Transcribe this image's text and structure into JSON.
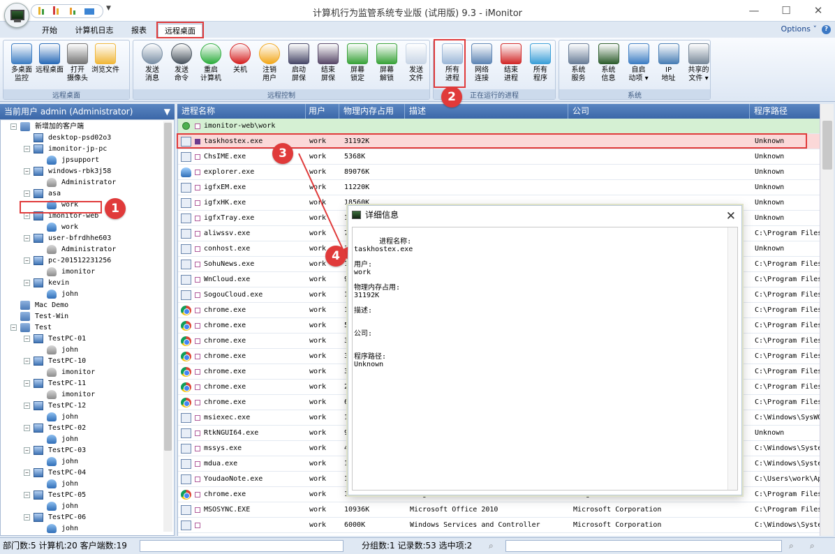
{
  "window": {
    "title": "计算机行为监管系统专业版 (试用版) 9.3 - iMonitor",
    "minimize": "—",
    "maximize": "☐",
    "close": "✕"
  },
  "tabs": [
    "开始",
    "计算机日志",
    "报表",
    "远程桌面"
  ],
  "options_label": "Options ˅",
  "help_label": "?",
  "ribbon": {
    "groups": [
      {
        "label": "远程桌面",
        "buttons": [
          {
            "l1": "多桌面",
            "l2": "监控",
            "icon": "multi-desktop-icon",
            "color": "#3f7fc4"
          },
          {
            "l1": "远程桌面",
            "l2": "",
            "icon": "remote-desktop-icon",
            "color": "#2b6cb8"
          },
          {
            "l1": "打开",
            "l2": "摄像头",
            "icon": "webcam-icon",
            "color": "#777777"
          },
          {
            "l1": "浏览文件",
            "l2": "",
            "icon": "folder-icon",
            "color": "#f0b73a"
          }
        ]
      },
      {
        "label": "远程控制",
        "buttons": [
          {
            "l1": "发送",
            "l2": "消息",
            "icon": "message-icon",
            "color": "#7a8fa5"
          },
          {
            "l1": "发送",
            "l2": "命令",
            "icon": "command-icon",
            "color": "#4a5560"
          },
          {
            "l1": "重启",
            "l2": "计算机",
            "icon": "restart-icon",
            "color": "#2fae3f"
          },
          {
            "l1": "关机",
            "l2": "",
            "icon": "shutdown-icon",
            "color": "#d52222"
          },
          {
            "l1": "注销",
            "l2": "用户",
            "icon": "logoff-key-icon",
            "color": "#f2a81d"
          },
          {
            "l1": "启动",
            "l2": "屏保",
            "icon": "screensaver-start-icon",
            "color": "#4a4a6a"
          },
          {
            "l1": "结束",
            "l2": "屏保",
            "icon": "screensaver-stop-icon",
            "color": "#5a4a6a"
          },
          {
            "l1": "屏幕",
            "l2": "锁定",
            "icon": "screen-lock-icon",
            "color": "#3aa33a"
          },
          {
            "l1": "屏幕",
            "l2": "解锁",
            "icon": "screen-unlock-icon",
            "color": "#3aa33a"
          },
          {
            "l1": "发送",
            "l2": "文件",
            "icon": "send-file-icon",
            "color": "#c9d6e6"
          }
        ]
      },
      {
        "label": "正在运行的进程",
        "buttons": [
          {
            "l1": "所有",
            "l2": "进程",
            "icon": "all-processes-icon",
            "color": "#9db8d8"
          },
          {
            "l1": "网络",
            "l2": "连接",
            "icon": "network-connection-icon",
            "color": "#5f86b5"
          },
          {
            "l1": "结束",
            "l2": "进程",
            "icon": "end-process-icon",
            "color": "#d22a2a"
          },
          {
            "l1": "所有",
            "l2": "程序",
            "icon": "all-programs-icon",
            "color": "#3b9fd8"
          }
        ]
      },
      {
        "label": "系统",
        "buttons": [
          {
            "l1": "系统",
            "l2": "服务",
            "icon": "system-services-icon",
            "color": "#6b7f99"
          },
          {
            "l1": "系统",
            "l2": "信息",
            "icon": "system-info-icon",
            "color": "#2f5f2f"
          },
          {
            "l1": "自启",
            "l2": "动项 ▾",
            "icon": "startup-gear-icon",
            "color": "#3f7fc4"
          },
          {
            "l1": "IP",
            "l2": "地址",
            "icon": "ip-address-icon",
            "color": "#4a7fb5"
          },
          {
            "l1": "共享的",
            "l2": "文件 ▾",
            "icon": "shared-files-icon",
            "color": "#7a8a9a"
          }
        ]
      }
    ]
  },
  "sidebar": {
    "header": "当前用户 admin (Administrator)",
    "tree": [
      {
        "t": "新增加的客户端",
        "lvl": 0,
        "icon": "net",
        "exp": "−"
      },
      {
        "t": "desktop-psd02o3",
        "lvl": 1,
        "icon": "pc",
        "exp": ""
      },
      {
        "t": "imonitor-jp-pc",
        "lvl": 1,
        "icon": "pc",
        "exp": "−"
      },
      {
        "t": "jpsupport",
        "lvl": 2,
        "icon": "user",
        "exp": ""
      },
      {
        "t": "windows-rbk3j58",
        "lvl": 1,
        "icon": "pc",
        "exp": "−"
      },
      {
        "t": "Administrator",
        "lvl": 2,
        "icon": "usergrey",
        "exp": ""
      },
      {
        "t": "asa",
        "lvl": 1,
        "icon": "pc",
        "exp": "−"
      },
      {
        "t": "work",
        "lvl": 2,
        "icon": "user",
        "exp": ""
      },
      {
        "t": "imonitor-web",
        "lvl": 1,
        "icon": "pc",
        "exp": "−"
      },
      {
        "t": "work",
        "lvl": 2,
        "icon": "user",
        "exp": ""
      },
      {
        "t": "user-bfrdhhe603",
        "lvl": 1,
        "icon": "pc",
        "exp": "−"
      },
      {
        "t": "Administrator",
        "lvl": 2,
        "icon": "usergrey",
        "exp": ""
      },
      {
        "t": "pc-201512231256",
        "lvl": 1,
        "icon": "pc",
        "exp": "−"
      },
      {
        "t": "imonitor",
        "lvl": 2,
        "icon": "usergrey",
        "exp": ""
      },
      {
        "t": "kevin",
        "lvl": 1,
        "icon": "pc",
        "exp": "−"
      },
      {
        "t": "john",
        "lvl": 2,
        "icon": "user",
        "exp": ""
      },
      {
        "t": "Mac Demo",
        "lvl": 0,
        "icon": "net",
        "exp": ""
      },
      {
        "t": "Test-Win",
        "lvl": 0,
        "icon": "net",
        "exp": ""
      },
      {
        "t": "Test",
        "lvl": 0,
        "icon": "net",
        "exp": "−"
      },
      {
        "t": "TestPC-01",
        "lvl": 1,
        "icon": "pc",
        "exp": "−"
      },
      {
        "t": "john",
        "lvl": 2,
        "icon": "usergrey",
        "exp": ""
      },
      {
        "t": "TestPC-10",
        "lvl": 1,
        "icon": "pc",
        "exp": "−"
      },
      {
        "t": "imonitor",
        "lvl": 2,
        "icon": "usergrey",
        "exp": ""
      },
      {
        "t": "TestPC-11",
        "lvl": 1,
        "icon": "pc",
        "exp": "−"
      },
      {
        "t": "imonitor",
        "lvl": 2,
        "icon": "usergrey",
        "exp": ""
      },
      {
        "t": "TestPC-12",
        "lvl": 1,
        "icon": "pc",
        "exp": "−"
      },
      {
        "t": "john",
        "lvl": 2,
        "icon": "user",
        "exp": ""
      },
      {
        "t": "TestPC-02",
        "lvl": 1,
        "icon": "pc",
        "exp": "−"
      },
      {
        "t": "john",
        "lvl": 2,
        "icon": "user",
        "exp": ""
      },
      {
        "t": "TestPC-03",
        "lvl": 1,
        "icon": "pc",
        "exp": "−"
      },
      {
        "t": "john",
        "lvl": 2,
        "icon": "user",
        "exp": ""
      },
      {
        "t": "TestPC-04",
        "lvl": 1,
        "icon": "pc",
        "exp": "−"
      },
      {
        "t": "john",
        "lvl": 2,
        "icon": "user",
        "exp": ""
      },
      {
        "t": "TestPC-05",
        "lvl": 1,
        "icon": "pc",
        "exp": "−"
      },
      {
        "t": "john",
        "lvl": 2,
        "icon": "user",
        "exp": ""
      },
      {
        "t": "TestPC-06",
        "lvl": 1,
        "icon": "pc",
        "exp": "−"
      },
      {
        "t": "john",
        "lvl": 2,
        "icon": "user",
        "exp": ""
      }
    ]
  },
  "grid": {
    "columns": [
      "进程名称",
      "用户",
      "物理内存占用",
      "描述",
      "公司",
      "程序路径"
    ],
    "group_label": "imonitor-web\\work",
    "rows": [
      {
        "icon": "app",
        "chk": "x",
        "name": "taskhostex.exe",
        "user": "work",
        "mem": "31192K",
        "desc": "",
        "company": "",
        "path": "Unknown",
        "sel": true
      },
      {
        "icon": "app",
        "chk": "",
        "name": "ChsIME.exe",
        "user": "work",
        "mem": "5368K",
        "desc": "",
        "company": "",
        "path": "Unknown"
      },
      {
        "icon": "explorer",
        "chk": "",
        "name": "explorer.exe",
        "user": "work",
        "mem": "89076K",
        "desc": "",
        "company": "",
        "path": "Unknown"
      },
      {
        "icon": "app",
        "chk": "",
        "name": "igfxEM.exe",
        "user": "work",
        "mem": "11220K",
        "desc": "",
        "company": "",
        "path": "Unknown"
      },
      {
        "icon": "app",
        "chk": "",
        "name": "igfxHK.exe",
        "user": "work",
        "mem": "18560K",
        "desc": "",
        "company": "",
        "path": "Unknown"
      },
      {
        "icon": "app",
        "chk": "",
        "name": "igfxTray.exe",
        "user": "work",
        "mem": "1(",
        "desc": "",
        "company": "",
        "path": "Unknown"
      },
      {
        "icon": "app",
        "chk": "",
        "name": "aliwssv.exe",
        "user": "work",
        "mem": "7!",
        "desc": "",
        "company": "",
        "path": "C:\\Program Files"
      },
      {
        "icon": "app",
        "chk": "",
        "name": "conhost.exe",
        "user": "work",
        "mem": "3!",
        "desc": "",
        "company": "",
        "path": "Unknown"
      },
      {
        "icon": "app",
        "chk": "",
        "name": "SohuNews.exe",
        "user": "work",
        "mem": "1:",
        "desc": "",
        "company": "",
        "path": "C:\\Program Files"
      },
      {
        "icon": "app",
        "chk": "",
        "name": "WnCloud.exe",
        "user": "work",
        "mem": "9(",
        "desc": "",
        "company": "",
        "path": "C:\\Program Files"
      },
      {
        "icon": "app",
        "chk": "",
        "name": "SogouCloud.exe",
        "user": "work",
        "mem": "1:",
        "desc": "",
        "company": "",
        "path": "C:\\Program Files"
      },
      {
        "icon": "chrome",
        "chk": "",
        "name": "chrome.exe",
        "user": "work",
        "mem": "1!",
        "desc": "",
        "company": "",
        "path": "C:\\Program Files"
      },
      {
        "icon": "chrome",
        "chk": "",
        "name": "chrome.exe",
        "user": "work",
        "mem": "5(",
        "desc": "",
        "company": "",
        "path": "C:\\Program Files"
      },
      {
        "icon": "chrome",
        "chk": "",
        "name": "chrome.exe",
        "user": "work",
        "mem": "3:",
        "desc": "",
        "company": "",
        "path": "C:\\Program Files"
      },
      {
        "icon": "chrome",
        "chk": "",
        "name": "chrome.exe",
        "user": "work",
        "mem": "3(",
        "desc": "",
        "company": "",
        "path": "C:\\Program Files"
      },
      {
        "icon": "chrome",
        "chk": "",
        "name": "chrome.exe",
        "user": "work",
        "mem": "3:",
        "desc": "",
        "company": "",
        "path": "C:\\Program Files"
      },
      {
        "icon": "chrome",
        "chk": "",
        "name": "chrome.exe",
        "user": "work",
        "mem": "2:",
        "desc": "",
        "company": "",
        "path": "C:\\Program Files"
      },
      {
        "icon": "chrome",
        "chk": "",
        "name": "chrome.exe",
        "user": "work",
        "mem": "6:",
        "desc": "",
        "company": "",
        "path": "C:\\Program Files"
      },
      {
        "icon": "msi",
        "chk": "",
        "name": "msiexec.exe",
        "user": "work",
        "mem": "1",
        "desc": "",
        "company": "",
        "path": "C:\\Windows\\SysWO"
      },
      {
        "icon": "app",
        "chk": "",
        "name": "RtkNGUI64.exe",
        "user": "work",
        "mem": "9:",
        "desc": "",
        "company": "",
        "path": "Unknown"
      },
      {
        "icon": "app",
        "chk": "",
        "name": "mssys.exe",
        "user": "work",
        "mem": "4:",
        "desc": "",
        "company": "",
        "path": "C:\\Windows\\Syste"
      },
      {
        "icon": "app",
        "chk": "",
        "name": "mdua.exe",
        "user": "work",
        "mem": "1",
        "desc": "",
        "company": "",
        "path": "C:\\Windows\\Syste"
      },
      {
        "icon": "app",
        "chk": "",
        "name": "YoudaoNote.exe",
        "user": "work",
        "mem": "1",
        "desc": "",
        "company": "",
        "path": "C:\\Users\\work\\Ap"
      },
      {
        "icon": "chrome",
        "chk": "",
        "name": "chrome.exe",
        "user": "work",
        "mem": "121660K",
        "desc": "Google Chrome",
        "company": "Google Inc.",
        "path": "C:\\Program Files"
      },
      {
        "icon": "app",
        "chk": "",
        "name": "MSOSYNC.EXE",
        "user": "work",
        "mem": "10936K",
        "desc": "Microsoft Office 2010",
        "company": "Microsoft Corporation",
        "path": "C:\\Program Files"
      },
      {
        "icon": "app",
        "chk": "",
        "name": "",
        "user": "work",
        "mem": "6000K",
        "desc": "Windows Services and Controller",
        "company": "Microsoft Corporation",
        "path": "C:\\Windows\\Syste"
      }
    ]
  },
  "dialog": {
    "title": "详细信息",
    "close": "✕",
    "body": "进程名称:\ntaskhostex.exe\n\n用户:\nwork\n\n物理内存占用:\n31192K\n\n描述:\n\n\n公司:\n\n\n程序路径:\nUnknown"
  },
  "status": {
    "left": "部门数:5 计算机:20 客户端数:19",
    "right": "分组数:1  记录数:53  选中项:2"
  },
  "callouts": [
    "1",
    "2",
    "3",
    "4"
  ],
  "colors": {
    "accent": "#3b67a8",
    "callout": "#e03a3a",
    "selected_row": "#fbd8d8",
    "group_row": "#d5f0d3"
  }
}
